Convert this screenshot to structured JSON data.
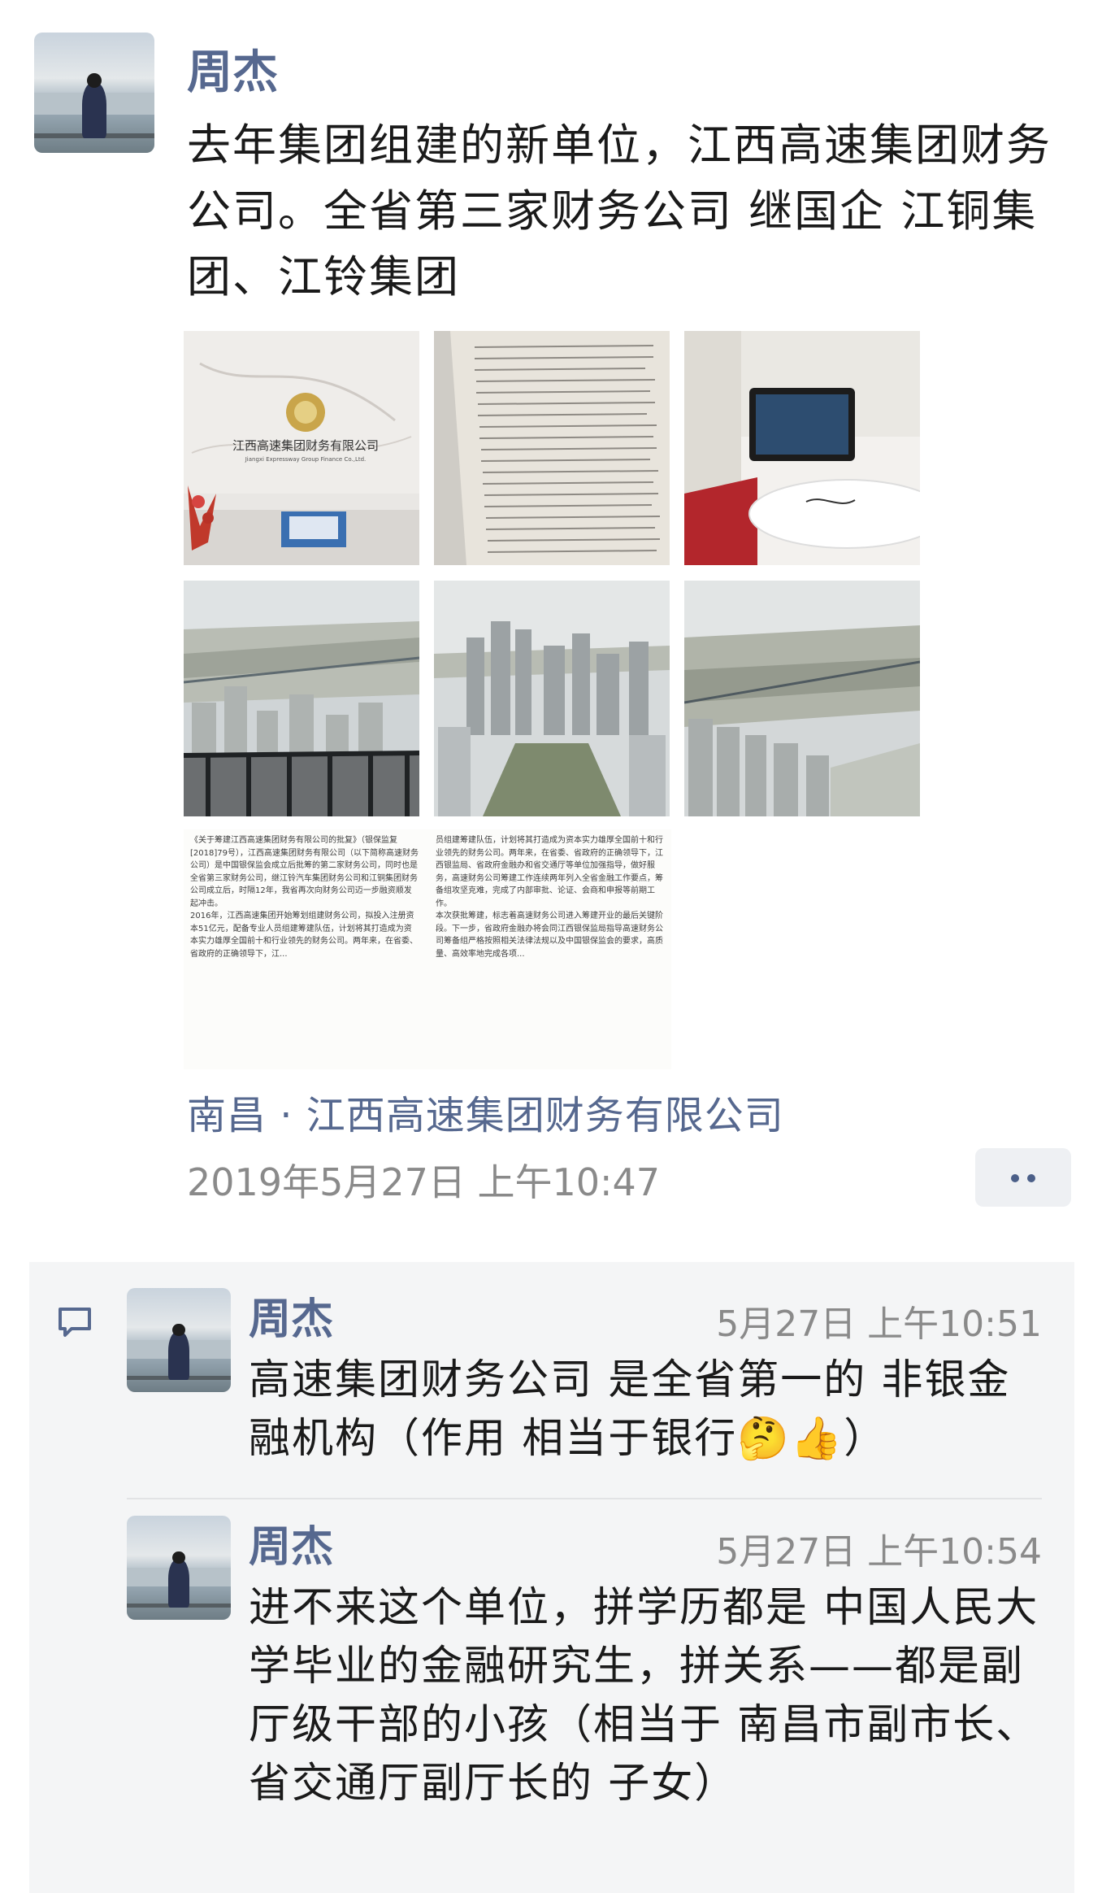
{
  "post": {
    "author": "周杰",
    "text": "去年集团组建的新单位，江西高速集团财务公司。全省第三家财务公司 继国企 江铜集团、江铃集团",
    "images": [
      {
        "label": "江西高速集团财务有限公司",
        "sublabel": "Jiangxi Expressway Group Finance Co.,Ltd."
      },
      {
        "label": ""
      },
      {
        "label": ""
      },
      {
        "label": ""
      },
      {
        "label": ""
      },
      {
        "label": ""
      }
    ],
    "document_image": {
      "left_column": "《关于筹建江西高速集团财务有限公司的批复》（银保监复[2018]79号），江西高速集团财务有限公司（以下简称高速财务公司）是中国银保监会成立后批筹的第二家财务公司，同时也是全省第三家财务公司，继江铃汽车集团财务公司和江铜集团财务公司成立后，时隔12年，我省再次向财务公司迈一步融资顺发起冲击。\n2016年，江西高速集团开始筹划组建财务公司，拟投入注册资本51亿元，配备专业人员组建筹建队伍，计划将其打造成为资本实力雄厚全国前十和行业领先的财务公司。两年来，在省委、省政府的正确领导下，江...",
      "right_column": "员组建筹建队伍，计划将其打造成为资本实力雄厚全国前十和行业领先的财务公司。两年来，在省委、省政府的正确领导下，江西银监局、省政府金融办和省交通厅等单位加强指导，做好服务，高速财务公司筹建工作连续两年列入全省金融工作要点，筹备组攻坚克难，完成了内部审批、论证、会商和申报等前期工作。\n本次获批筹建，标志着高速财务公司进入筹建开业的最后关键阶段。下一步，省政府金融办将会同江西银保监局指导高速财务公司筹备组严格按照相关法律法规以及中国银保监会的要求，高质量、高效率地完成各项..."
    },
    "location": "南昌 · 江西高速集团财务有限公司",
    "timestamp": "2019年5月27日 上午10:47"
  },
  "comments": [
    {
      "author": "周杰",
      "time": "5月27日 上午10:51",
      "text": "高速集团财务公司 是全省第一的 非银金融机构（作用 相当于银行",
      "emoji": "🤔👍",
      "text_end": "）"
    },
    {
      "author": "周杰",
      "time": "5月27日 上午10:54",
      "text": "进不来这个单位，拼学历都是 中国人民大学毕业的金融研究生，拼关系——都是副厅级干部的小孩（相当于 南昌市副市长、 省交通厅副厅长的 子女）"
    }
  ],
  "icons": {
    "more": "more-dots-icon",
    "comment": "comment-icon"
  },
  "colors": {
    "name_link": "#56688f",
    "timestamp": "#8a8a8a",
    "panel_bg": "#f4f5f6"
  }
}
